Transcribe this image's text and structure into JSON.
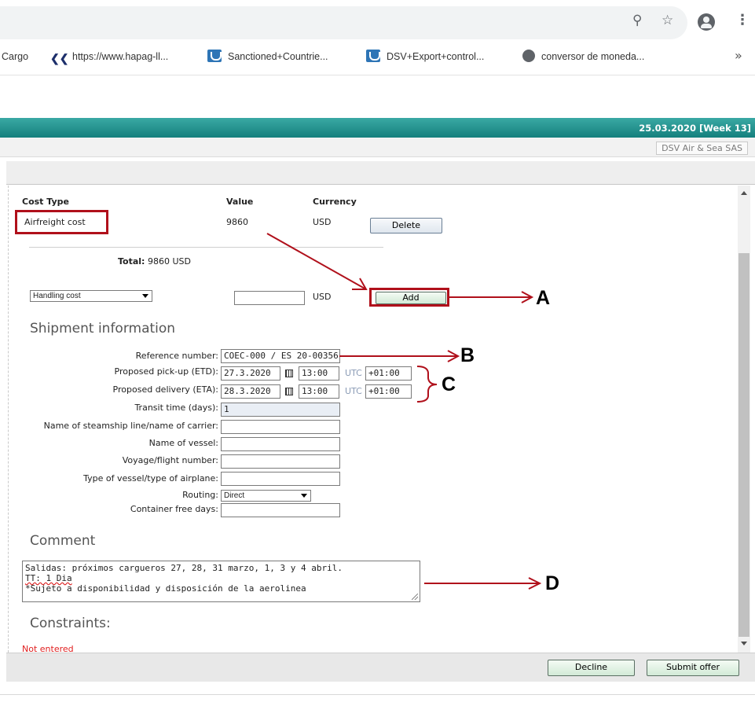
{
  "browser": {
    "bookmarks": [
      {
        "label": "Cargo",
        "icon": "bookmark-favicon"
      },
      {
        "label": "https://www.hapag-ll...",
        "icon": "hapag-lloyd-icon"
      },
      {
        "label": "Sanctioned+Countrie...",
        "icon": "dsv-shield-icon"
      },
      {
        "label": "DSV+Export+control...",
        "icon": "dsv-shield-icon"
      },
      {
        "label": "conversor de moneda...",
        "icon": "globe-icon"
      }
    ],
    "more_bookmarks": "»",
    "icons": {
      "zoom": "zoom-icon",
      "star": "star-icon",
      "account": "account-icon",
      "menu": "more-vert-icon"
    }
  },
  "header": {
    "date": "25.03.2020 [Week 13]",
    "company": "DSV Air & Sea SAS",
    "accent_color": "#1b8a87"
  },
  "costs": {
    "columns": [
      "Cost Type",
      "Value",
      "Currency"
    ],
    "rows": [
      {
        "type": "Airfreight cost",
        "value": "9860",
        "currency": "USD",
        "action": "Delete"
      }
    ],
    "total_label": "Total:",
    "total_value": "9860 USD",
    "new_cost": {
      "type": "Handling cost",
      "value": "",
      "currency": "USD",
      "action": "Add"
    }
  },
  "shipment": {
    "title": "Shipment information",
    "reference": {
      "label": "Reference number:",
      "value": "COEC-000 / ES 20-00356"
    },
    "pickup": {
      "label": "Proposed pick-up (ETD):",
      "date": "27.3.2020",
      "time": "13:00",
      "tz_label": "UTC",
      "offset": "+01:00"
    },
    "delivery": {
      "label": "Proposed delivery (ETA):",
      "date": "28.3.2020",
      "time": "13:00",
      "tz_label": "UTC",
      "offset": "+01:00"
    },
    "transit": {
      "label": "Transit time (days):",
      "value": "1"
    },
    "carrier": {
      "label": "Name of steamship line/name of carrier:",
      "value": ""
    },
    "vessel": {
      "label": "Name of vessel:",
      "value": ""
    },
    "voyage": {
      "label": "Voyage/flight number:",
      "value": ""
    },
    "vessel_type": {
      "label": "Type of vessel/type of airplane:",
      "value": ""
    },
    "routing": {
      "label": "Routing:",
      "value": "Direct"
    },
    "free_days": {
      "label": "Container free days:",
      "value": ""
    }
  },
  "comment": {
    "title": "Comment",
    "lines": [
      "Salidas: próximos cargueros 27, 28, 31 marzo, 1, 3 y 4 abril.",
      "TT: 1 Dia",
      "*Sujeto a disponibilidad y disposición de la aerolinea"
    ]
  },
  "constraints": {
    "title": "Constraints:",
    "status": "Not entered"
  },
  "footer": {
    "decline": "Decline",
    "submit": "Submit offer"
  },
  "annotations": {
    "a": "A",
    "b": "B",
    "c": "C",
    "d": "D",
    "highlight_color": "#b0101b"
  }
}
